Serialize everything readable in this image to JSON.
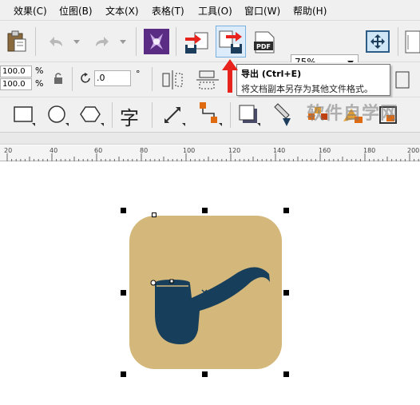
{
  "menubar": {
    "items": [
      "效果(C)",
      "位图(B)",
      "文本(X)",
      "表格(T)",
      "工具(O)",
      "窗口(W)",
      "帮助(H)"
    ]
  },
  "toolbar": {
    "zoom_value": "75%",
    "export_pdf_label": "PDF"
  },
  "property_bar": {
    "scale_x": "100.0",
    "scale_y": "100.0",
    "scale_unit_x": "%",
    "scale_unit_y": "%",
    "rotation": ".0",
    "rotation_unit": "°"
  },
  "toolbox": {
    "text_tool_glyph": "字"
  },
  "tooltip": {
    "title": "导出 (Ctrl+E)",
    "description": "将文档副本另存为其他文件格式。"
  },
  "watermark": {
    "text": "软件自学网"
  },
  "ruler": {
    "labels": [
      "20",
      "40",
      "60",
      "80",
      "100",
      "120",
      "140",
      "160",
      "180",
      "200"
    ]
  },
  "colors": {
    "icon_background": "#d4b77a",
    "pipe": "#173e5a",
    "export_arrow": "#e8231e",
    "accent_purple": "#5b2c83"
  },
  "icons": {
    "paste": "clipboard-icon",
    "undo": "undo-icon",
    "redo": "redo-icon",
    "corel_connect": "corel-connect-icon",
    "import": "import-icon",
    "export": "export-icon",
    "publish_pdf": "pdf-icon",
    "fullscreen": "fullscreen-icon"
  }
}
